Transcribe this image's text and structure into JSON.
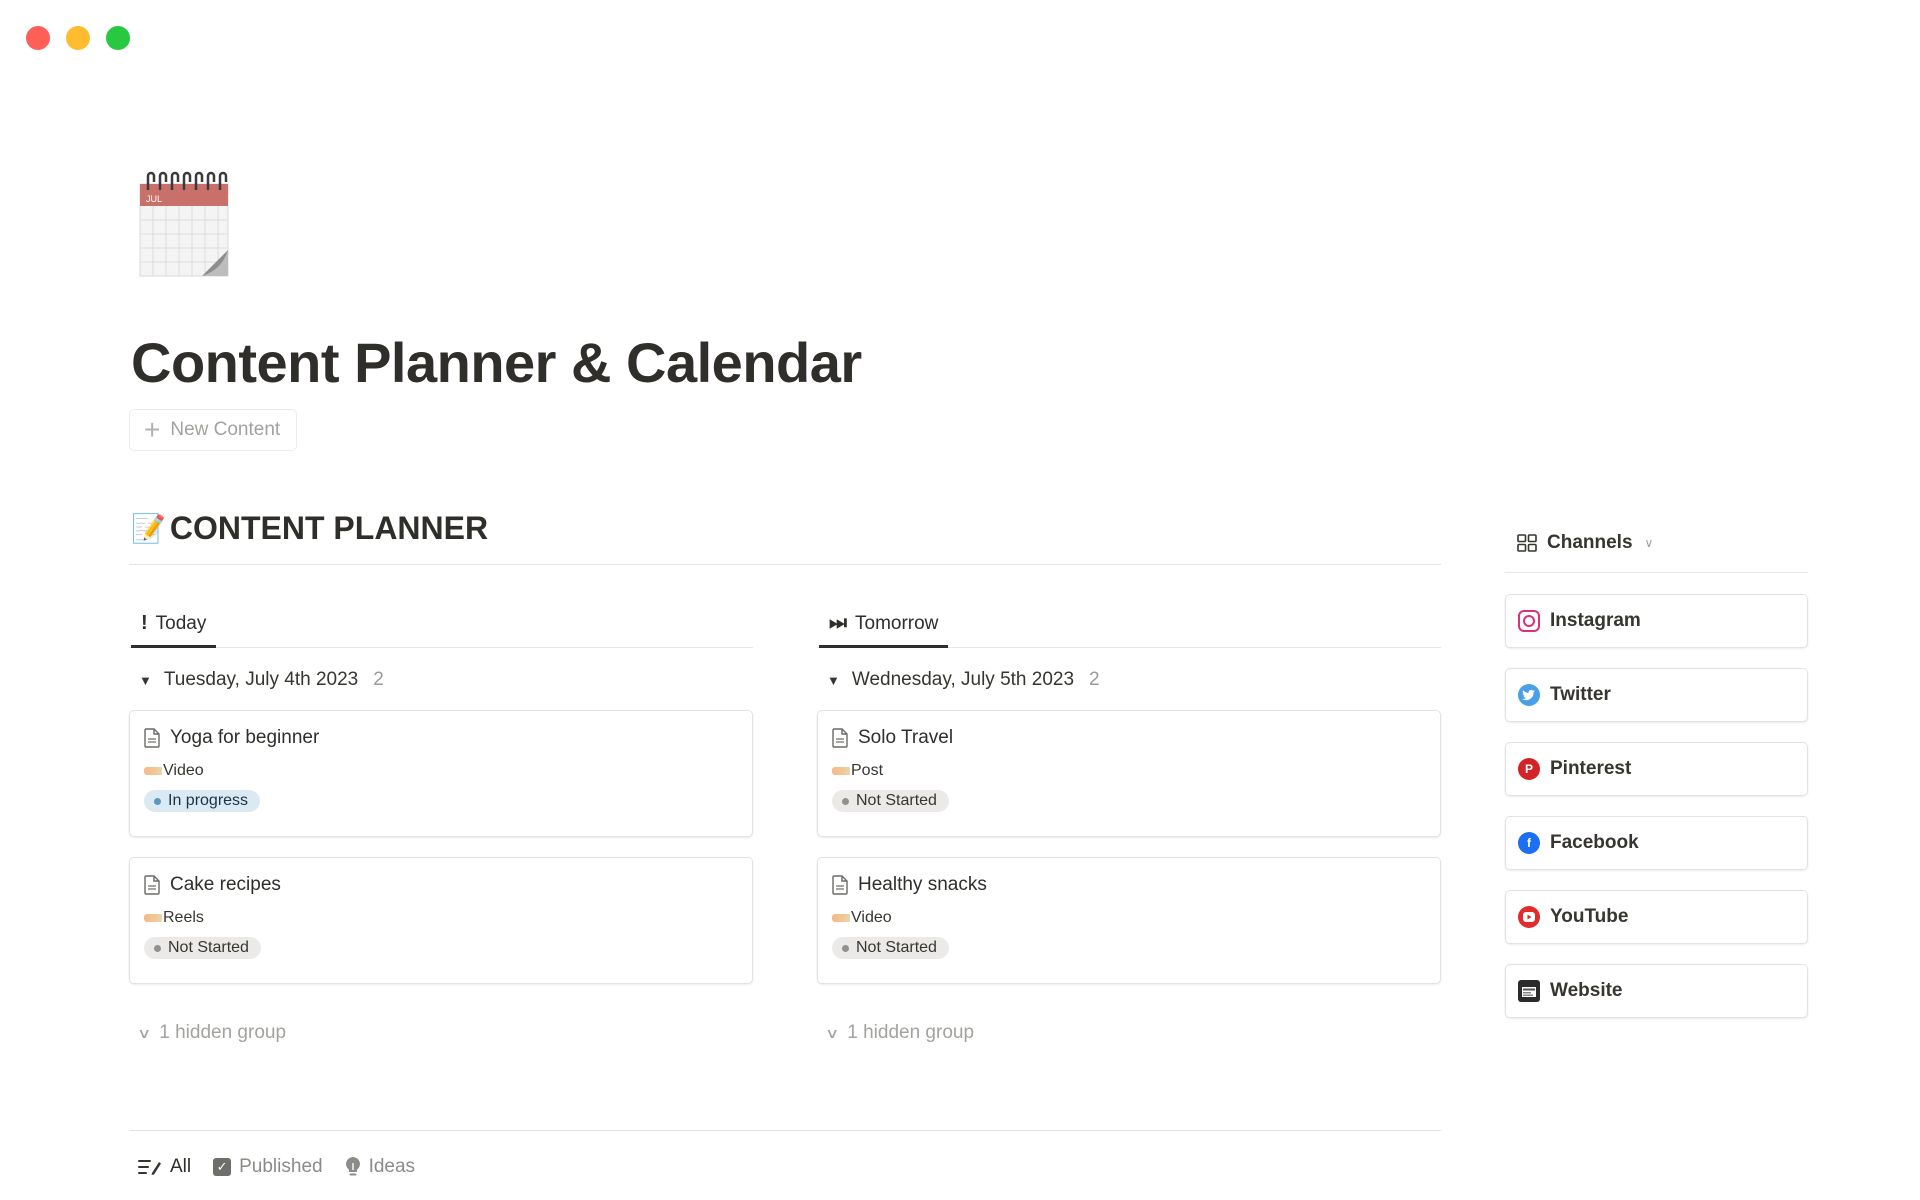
{
  "window": {
    "controls": [
      "close",
      "minimize",
      "zoom"
    ]
  },
  "page": {
    "icon": "spiral-calendar-icon",
    "icon_month": "JUL",
    "title": "Content Planner & Calendar",
    "new_button": "New Content"
  },
  "planner": {
    "heading_emoji": "📝",
    "heading": "CONTENT PLANNER",
    "boards": [
      {
        "tab_icon": "!",
        "tab_label": "Today",
        "group_label": "Tuesday, July 4th 2023",
        "group_count": "2",
        "cards": [
          {
            "title": "Yoga for beginner",
            "type": "Video",
            "status": "In progress"
          },
          {
            "title": "Cake recipes",
            "type": "Reels",
            "status": "Not Started"
          }
        ],
        "hidden": "1 hidden group"
      },
      {
        "tab_icon": "⏭",
        "tab_label": "Tomorrow",
        "group_label": "Wednesday, July 5th 2023",
        "group_count": "2",
        "cards": [
          {
            "title": "Solo Travel",
            "type": "Post",
            "status": "Not Started"
          },
          {
            "title": "Healthy snacks",
            "type": "Video",
            "status": "Not Started"
          }
        ],
        "hidden": "1 hidden group"
      }
    ]
  },
  "bottom_tabs": [
    {
      "label": "All",
      "icon": "list-edit-icon"
    },
    {
      "label": "Published",
      "icon": "checkbox-icon"
    },
    {
      "label": "Ideas",
      "icon": "lightbulb-icon"
    }
  ],
  "channels": {
    "heading": "Channels",
    "items": [
      {
        "label": "Instagram",
        "icon": "instagram-icon",
        "color": "#d9317a"
      },
      {
        "label": "Twitter",
        "icon": "twitter-icon",
        "color": "#4a9fe8"
      },
      {
        "label": "Pinterest",
        "icon": "pinterest-icon",
        "color": "#d32326"
      },
      {
        "label": "Facebook",
        "icon": "facebook-icon",
        "color": "#1c6ef2"
      },
      {
        "label": "YouTube",
        "icon": "youtube-icon",
        "color": "#e22c2c"
      },
      {
        "label": "Website",
        "icon": "website-icon",
        "color": "#2b2b2b"
      }
    ]
  },
  "colors": {
    "status_in_progress_bg": "#dbe9f3",
    "status_not_started_bg": "#ebeae8",
    "text": "#37352f"
  }
}
